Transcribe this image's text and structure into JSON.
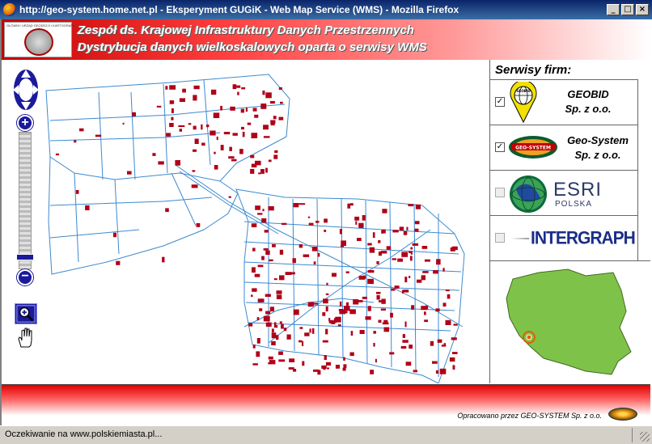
{
  "window": {
    "title": "http://geo-system.home.net.pl - Eksperyment GUGiK - Web Map Service (WMS) - Mozilla Firefox",
    "minimize": "_",
    "maximize": "□",
    "close": "×"
  },
  "header": {
    "logo_text": "GŁÓWNY URZĄD GEODEZJI I KARTOGRAFII",
    "line1": "Zespół ds. Krajowej Infrastruktury Danych Przestrzennych",
    "line2": "Dystrybucja danych wielkoskalowych oparta o serwisy WMS"
  },
  "map_tools": {
    "zoom_in": "+",
    "zoom_out": "−"
  },
  "panel": {
    "title": "Serwisy firm:",
    "services": [
      {
        "name_line1": "GEOBID",
        "name_line2": "Sp. z o.o.",
        "checked": "✓",
        "logo_text": "GEOBID"
      },
      {
        "name_line1": "Geo-System",
        "name_line2": "Sp. z o.o.",
        "checked": "✓",
        "logo_text": "GEO-SYSTEM"
      },
      {
        "name_line1": "ESRI",
        "name_line2": "POLSKA",
        "checked": ""
      },
      {
        "name_line1": "INTERGRAPH",
        "name_line2": "",
        "checked": ""
      }
    ]
  },
  "footer": {
    "credit": "Opracowano przez GEO-SYSTEM Sp. z o.o."
  },
  "status": {
    "text": "Oczekiwanie na www.polskiemiasta.pl..."
  },
  "colors": {
    "building": "#b00018",
    "street": "#3c8ad0",
    "brand_red": "#e00000",
    "nav_blue": "#1a1a9a",
    "poland_fill": "#7fc24a"
  }
}
